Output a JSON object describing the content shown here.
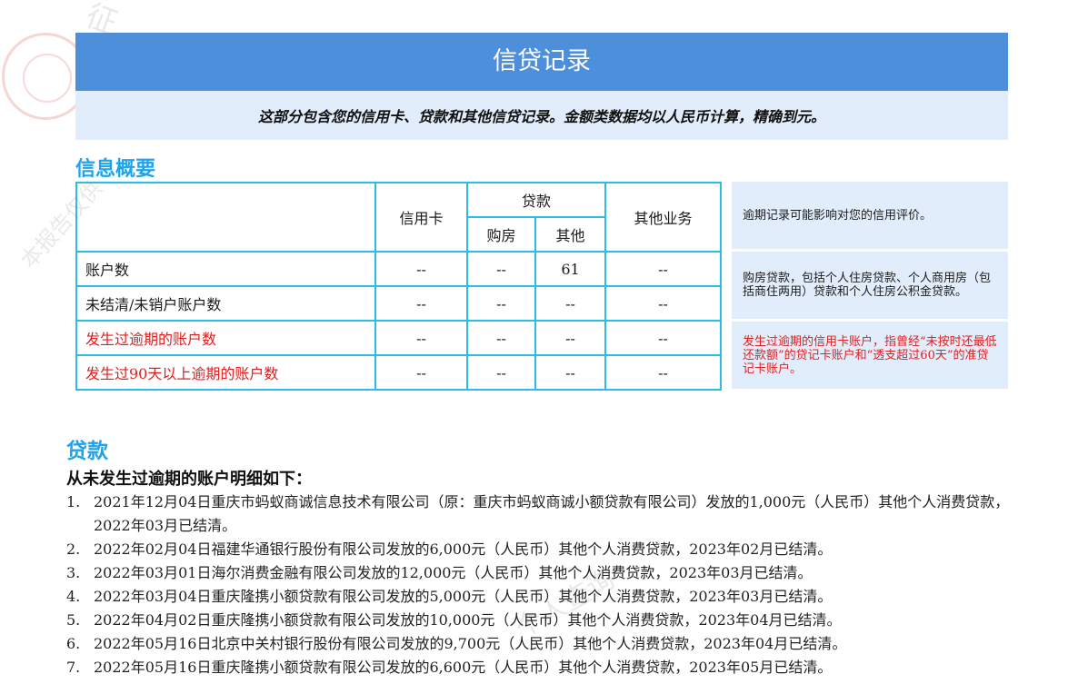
{
  "header": {
    "title": "信贷记录",
    "subtitle": "这部分包含您的信用卡、贷款和其他信贷记录。金额类数据均以人民币计算，精确到元。"
  },
  "overview": {
    "title": "信息概要",
    "col_credit_card": "信用卡",
    "col_loan": "贷款",
    "col_house": "购房",
    "col_other": "其他",
    "col_other_business": "其他业务",
    "rows": [
      {
        "label": "账户数",
        "values": [
          "--",
          "--",
          "61",
          "--"
        ]
      },
      {
        "label": "未结清/未销户账户数",
        "values": [
          "--",
          "--",
          "--",
          "--"
        ]
      },
      {
        "label": "发生过逾期的账户数",
        "values": [
          "--",
          "--",
          "--",
          "--"
        ]
      },
      {
        "label": "发生过90天以上逾期的账户数",
        "values": [
          "--",
          "--",
          "--",
          "--"
        ]
      }
    ],
    "notes": [
      "逾期记录可能影响对您的信用评价。",
      "购房贷款，包括个人住房贷款、个人商用房（包括商住两用）贷款和个人住房公积金贷款。",
      "发生过逾期的信用卡账户，指曾经“未按时还最低还款额”的贷记卡账户和“透支超过60天”的准贷记卡账户。"
    ]
  },
  "loans": {
    "title": "贷款",
    "subtitle": "从未发生过逾期的账户明细如下：",
    "items": [
      {
        "num": "1.",
        "text": "2021年12月04日重庆市蚂蚁商诚信息技术有限公司（原：重庆市蚂蚁商诚小额贷款有限公司）发放的1,000元（人民币）其他个人消费贷款，2022年03月已结清。"
      },
      {
        "num": "2.",
        "text": "2022年02月04日福建华通银行股份有限公司发放的6,000元（人民币）其他个人消费贷款，2023年02月已结清。"
      },
      {
        "num": "3.",
        "text": "2022年03月01日海尔消费金融有限公司发放的12,000元（人民币）其他个人消费贷款，2023年03月已结清。"
      },
      {
        "num": "4.",
        "text": "2022年03月04日重庆隆携小额贷款有限公司发放的5,000元（人民币）其他个人消费贷款，2023年03月已结清。"
      },
      {
        "num": "5.",
        "text": "2022年04月02日重庆隆携小额贷款有限公司发放的10,000元（人民币）其他个人消费贷款，2023年04月已结清。"
      },
      {
        "num": "6.",
        "text": "2022年05月16日北京中关村银行股份有限公司发放的9,700元（人民币）其他个人消费贷款，2023年04月已结清。"
      },
      {
        "num": "7.",
        "text": "2022年05月16日重庆隆携小额贷款有限公司发放的6,600元（人民币）其他个人消费贷款，2023年05月已结清。"
      }
    ]
  },
  "watermark": {
    "text_a": "征",
    "text_b": "本报告仅供",
    "text_c": "个人查询"
  }
}
